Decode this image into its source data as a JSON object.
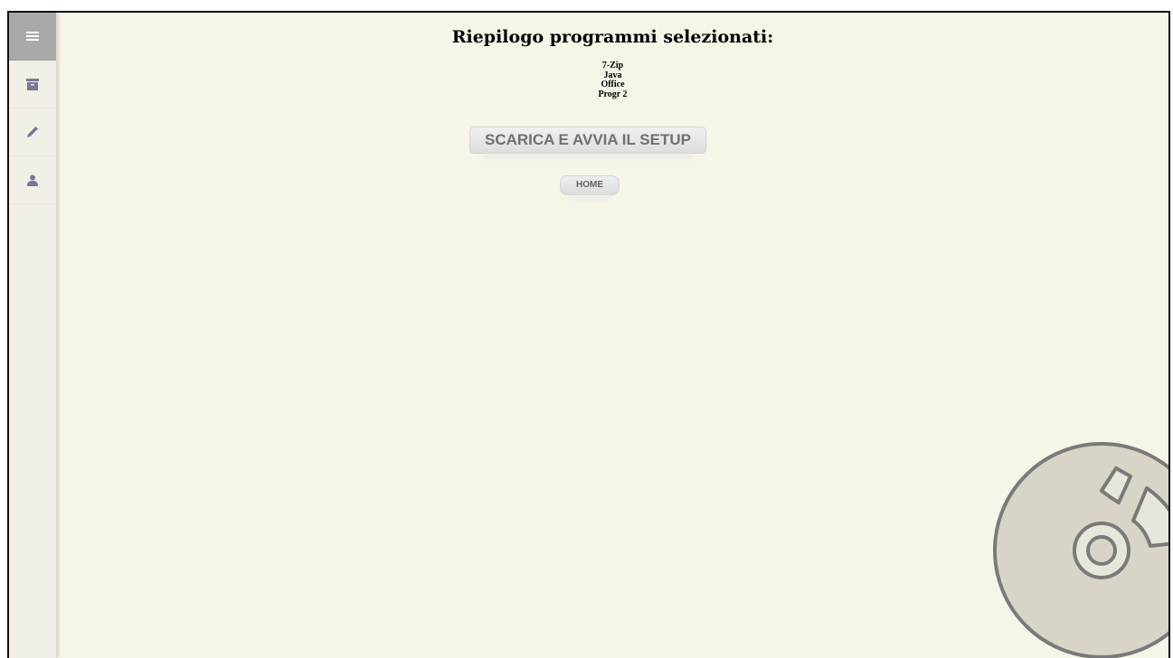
{
  "sidebar": {
    "items": [
      {
        "icon": "menu-icon",
        "active": true
      },
      {
        "icon": "archive-icon",
        "active": false
      },
      {
        "icon": "pencil-icon",
        "active": false
      },
      {
        "icon": "user-icon",
        "active": false
      }
    ],
    "icon_color": "#7b7597"
  },
  "main": {
    "title": "Riepilogo programmi selezionati:",
    "programs": [
      "7-Zip",
      "Java",
      "Office",
      "Progr 2"
    ],
    "setup_button_label": "SCARICA E AVVIA IL SETUP",
    "home_button_label": "HOME"
  },
  "decoration": {
    "icon": "disc-icon"
  }
}
